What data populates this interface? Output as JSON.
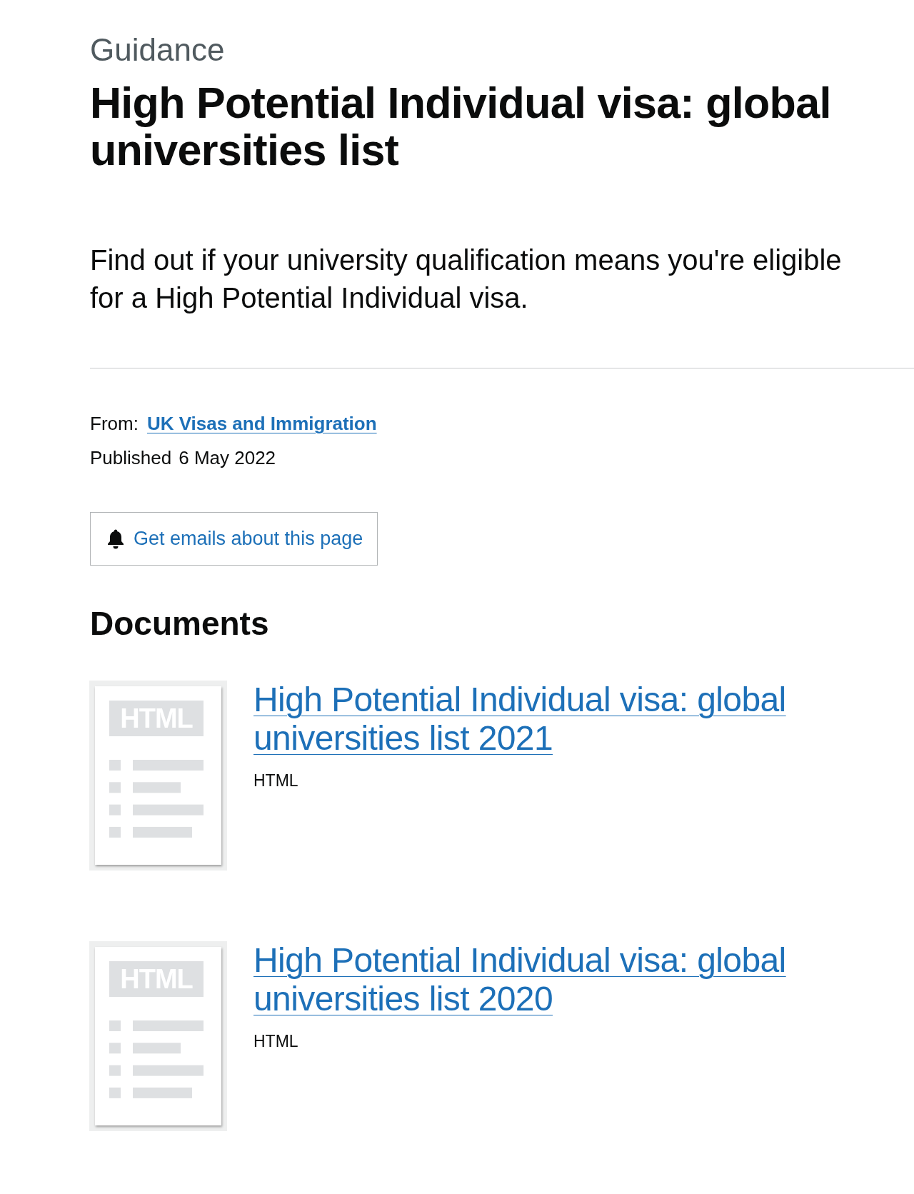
{
  "caption": "Guidance",
  "title": "High Potential Individual visa: global universities list",
  "lead": "Find out if your university qualification means you're eligible for a High Potential Individual visa.",
  "metadata": {
    "from_label": "From:",
    "from_link": "UK Visas and Immigration",
    "published_label": "Published",
    "published_date": "6 May 2022"
  },
  "subscribe_button": {
    "label": "Get emails about this page"
  },
  "documents_section": {
    "heading": "Documents",
    "documents": [
      {
        "thumbnail_label": "HTML",
        "title": "High Potential Individual visa: global universities list 2021",
        "format": "HTML"
      },
      {
        "thumbnail_label": "HTML",
        "title": "High Potential Individual visa: global universities list 2020",
        "format": "HTML"
      }
    ]
  }
}
